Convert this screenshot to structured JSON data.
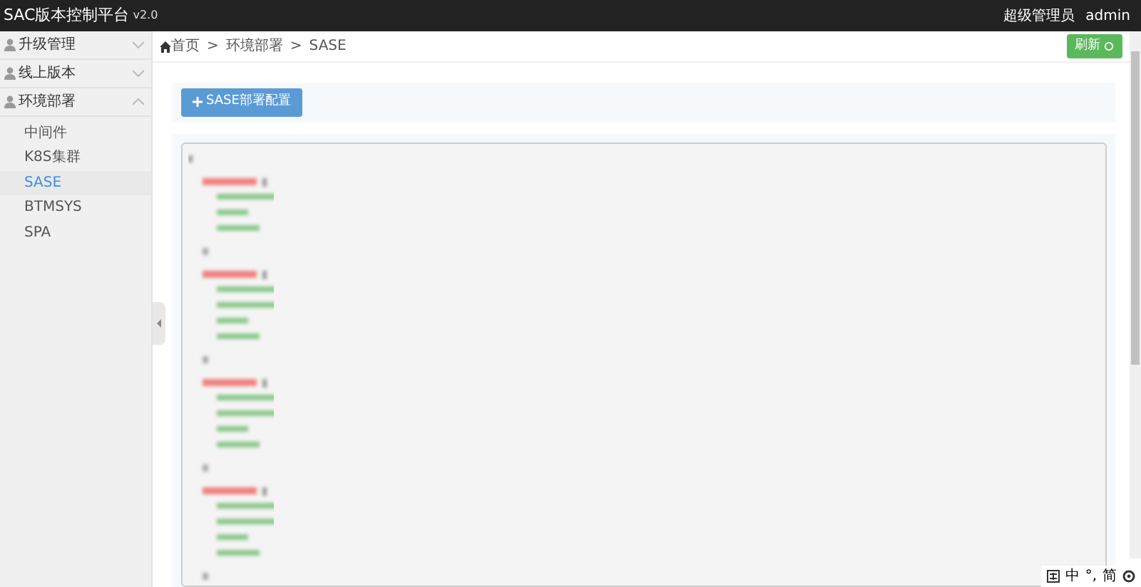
{
  "header": {
    "title": "SAC版本控制平台",
    "version": "v2.0",
    "role": "超级管理员",
    "user": "admin"
  },
  "sidebar": {
    "items": [
      {
        "label": "升级管理",
        "expanded": false
      },
      {
        "label": "线上版本",
        "expanded": false
      },
      {
        "label": "环境部署",
        "expanded": true,
        "children": [
          {
            "label": "中间件",
            "selected": false
          },
          {
            "label": "K8S集群",
            "selected": false
          },
          {
            "label": "SASE",
            "selected": true
          },
          {
            "label": "BTMSYS",
            "selected": false
          },
          {
            "label": "SPA",
            "selected": false
          }
        ]
      }
    ]
  },
  "breadcrumb": [
    "首页",
    "环境部署",
    "SASE"
  ],
  "breadcrumb_separators": [
    ">",
    ">"
  ],
  "refresh_button": "刷新",
  "config_button": "SASE部署配置",
  "ime_bar": [
    "中",
    "°,",
    "简"
  ]
}
